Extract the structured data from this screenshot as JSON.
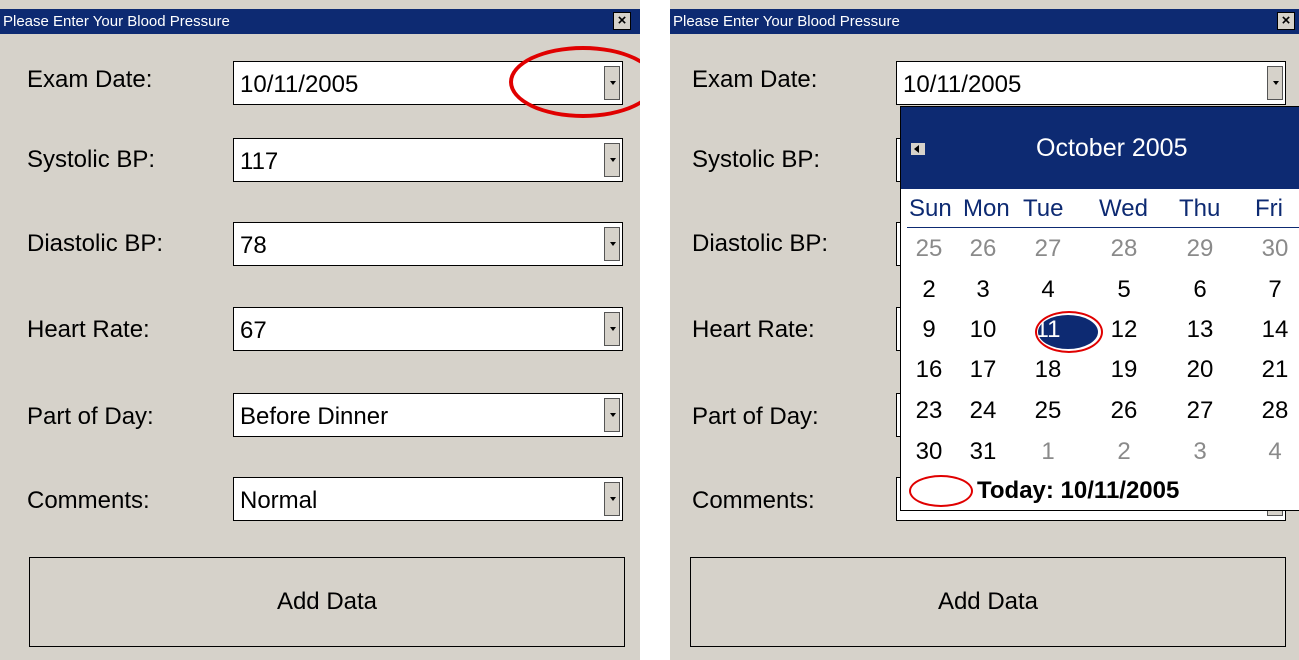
{
  "window": {
    "title": "Please Enter Your Blood Pressure",
    "close_glyph": "×"
  },
  "left": {
    "fields": [
      {
        "label": "Exam Date:",
        "value": "10/11/2005"
      },
      {
        "label": "Systolic BP:",
        "value": "117"
      },
      {
        "label": "Diastolic BP:",
        "value": "78"
      },
      {
        "label": "Heart Rate:",
        "value": "67"
      },
      {
        "label": "Part of Day:",
        "value": "Before Dinner"
      },
      {
        "label": "Comments:",
        "value": "Normal"
      }
    ],
    "add_label": "Add Data"
  },
  "right": {
    "labels": [
      "Exam Date:",
      "Systolic BP:",
      "Diastolic BP:",
      "Heart Rate:",
      "Part of Day:",
      "Comments:"
    ],
    "exam_date_value": "10/11/2005",
    "add_label": "Add Data",
    "calendar": {
      "month_title": "October 2005",
      "weekdays": [
        "Sun",
        "Mon",
        "Tue",
        "Wed",
        "Thu",
        "Fri"
      ],
      "weeks": [
        [
          "25",
          "26",
          "27",
          "28",
          "29",
          "30"
        ],
        [
          "2",
          "3",
          "4",
          "5",
          "6",
          "7"
        ],
        [
          "9",
          "10",
          "11",
          "12",
          "13",
          "14"
        ],
        [
          "16",
          "17",
          "18",
          "19",
          "20",
          "21"
        ],
        [
          "23",
          "24",
          "25",
          "26",
          "27",
          "28"
        ],
        [
          "30",
          "31",
          "1",
          "2",
          "3",
          "4"
        ]
      ],
      "selected_day": "11",
      "today_label": "Today: 10/11/2005"
    }
  },
  "colors": {
    "title_bar": "#0d2a72",
    "dialog_bg": "#d6d2ca",
    "annotation": "#e00000",
    "other_month_text": "#8a8a8a"
  }
}
